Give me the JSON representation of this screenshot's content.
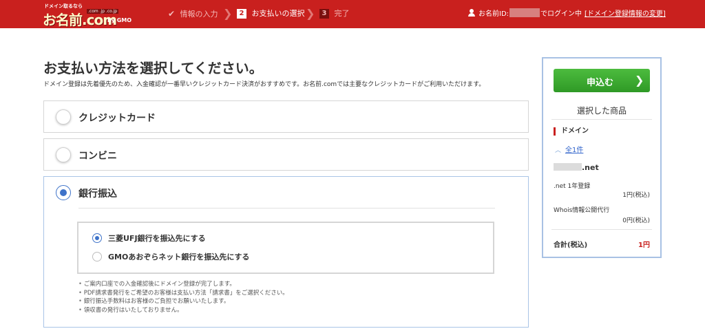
{
  "header": {
    "logo_tagline": "ドメイン取るなら",
    "logo_main": "お名前.com",
    "logo_sub": ".com .jp .co.jp",
    "logo_gmo": "by GMO",
    "steps": [
      {
        "num": "",
        "label": "情報の入力"
      },
      {
        "num": "2",
        "label": "お支払いの選択"
      },
      {
        "num": "3",
        "label": "完了"
      }
    ],
    "user_prefix": "お名前ID:",
    "user_suffix": "でログイン中",
    "user_link": "[ドメイン登録情報の変更]"
  },
  "main": {
    "title": "お支払い方法を選択してください。",
    "description": "ドメイン登録は先着優先のため、入金確認が一番早いクレジットカード決済がおすすめです。お名前.comでは主要なクレジットカードがご利用いただけます。",
    "options": [
      {
        "label": "クレジットカード",
        "selected": false
      },
      {
        "label": "コンビニ",
        "selected": false
      },
      {
        "label": "銀行振込",
        "selected": true
      }
    ],
    "banks": [
      {
        "label": "三菱UFJ銀行を振込先にする",
        "selected": true
      },
      {
        "label": "GMOあおぞらネット銀行を振込先にする",
        "selected": false
      }
    ],
    "notes": [
      "ご案内口座での入金確認後にドメイン登録が完了します。",
      "PDF請求書発行をご希望のお客様は支払い方法「請求書」をご選択ください。",
      "銀行振込手数料はお客様のご負担でお願いいたします。",
      "領収書の発行はいたしておりません。"
    ]
  },
  "sidebar": {
    "apply_label": "申込む",
    "selected_title": "選択した商品",
    "category": "ドメイン",
    "count_link": "全1件",
    "domain_suffix": ".net",
    "items": [
      {
        "name": ".net 1年登録",
        "price": "1円(税込)"
      },
      {
        "name": "Whois情報公開代行",
        "price": "0円(税込)"
      }
    ],
    "total_label": "合計(税込)",
    "total_value": "1円"
  },
  "colors": {
    "header_red": "#c9201e",
    "selected_blue": "#3d72c9",
    "apply_green": "#3aa82f"
  }
}
